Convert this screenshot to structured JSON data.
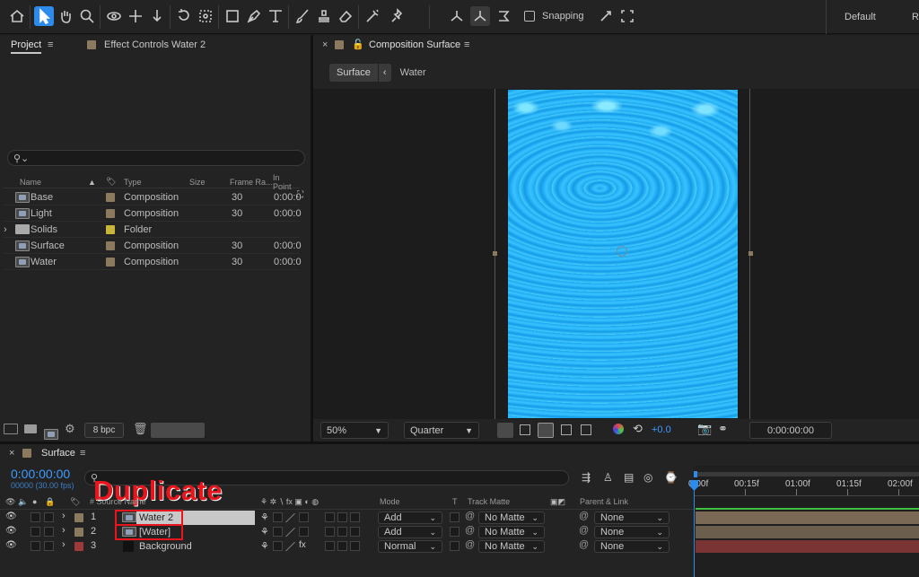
{
  "toolbar": {
    "snapping_label": "Snapping",
    "workspace_default": "Default",
    "workspace_next": "R"
  },
  "project_panel": {
    "tab_project": "Project",
    "tab_effect_controls": "Effect Controls Water 2",
    "search_placeholder": "",
    "columns": {
      "name": "Name",
      "type": "Type",
      "size": "Size",
      "frame_rate": "Frame Ra...",
      "in_point": "In Point"
    },
    "items": [
      {
        "name": "Base",
        "type": "Composition",
        "frame_rate": "30",
        "in_point": "0:00:0",
        "icon": "composition-icon",
        "color": "#8c7a5e"
      },
      {
        "name": "Light",
        "type": "Composition",
        "frame_rate": "30",
        "in_point": "0:00:0",
        "icon": "composition-icon",
        "color": "#8c7a5e"
      },
      {
        "name": "Solids",
        "type": "Folder",
        "frame_rate": "",
        "in_point": "",
        "icon": "folder-icon",
        "color": "#c9b43a"
      },
      {
        "name": "Surface",
        "type": "Composition",
        "frame_rate": "30",
        "in_point": "0:00:0",
        "icon": "composition-icon",
        "color": "#8c7a5e"
      },
      {
        "name": "Water",
        "type": "Composition",
        "frame_rate": "30",
        "in_point": "0:00:0",
        "icon": "composition-icon",
        "color": "#8c7a5e"
      }
    ],
    "bpc": "8 bpc"
  },
  "comp_panel": {
    "tab_title": "Composition Surface",
    "breadcrumb": [
      "Surface",
      "Water"
    ],
    "zoom": "50%",
    "resolution": "Quarter",
    "exposure": "+0.0",
    "timecode": "0:00:00:00"
  },
  "timeline": {
    "tab_title": "Surface",
    "timecode": "0:00:00:00",
    "fps_line": "00000 (30.00 fps)",
    "annotation": "Duplicate",
    "ruler": [
      "0:00f",
      "00:15f",
      "01:00f",
      "01:15f",
      "02:00f"
    ],
    "columns": {
      "source_name": "# Source Name",
      "mode": "Mode",
      "t": "T",
      "track_matte": "Track Matte",
      "parent": "Parent & Link"
    },
    "layers": [
      {
        "num": "1",
        "name": "Water 2",
        "mode": "Add",
        "matte": "No Matte",
        "parent": "None",
        "color": "#8c7a5e",
        "bar": "#7a6a55"
      },
      {
        "num": "2",
        "name": "[Water]",
        "mode": "Add",
        "matte": "No Matte",
        "parent": "None",
        "color": "#8c7a5e",
        "bar": "#6b5e4d"
      },
      {
        "num": "3",
        "name": "Background",
        "mode": "Normal",
        "matte": "No Matte",
        "parent": "None",
        "color": "#a03a3a",
        "bar": "#7a3434"
      }
    ]
  }
}
